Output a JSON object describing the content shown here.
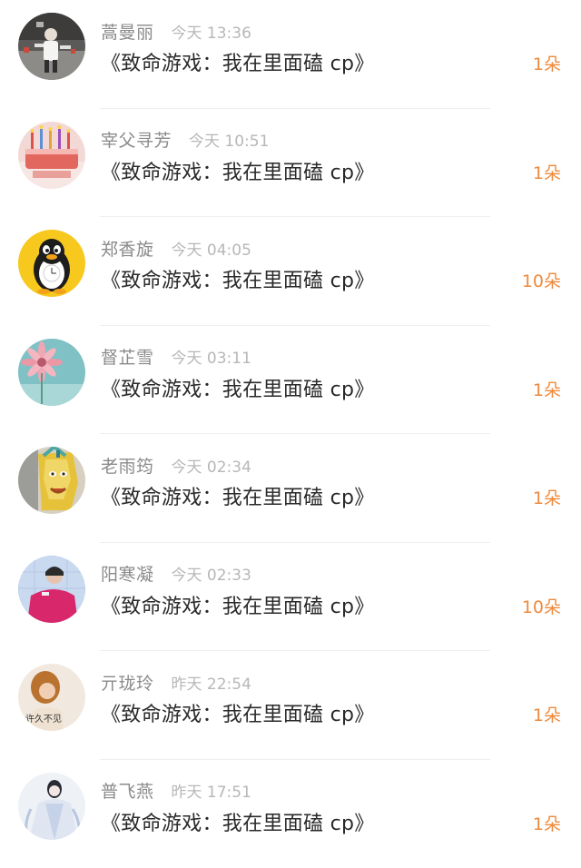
{
  "records": [
    {
      "name": "蒿曼丽",
      "time": "今天 13:36",
      "title": "《致命游戏：我在里面磕 cp》",
      "flowers": "1朵",
      "avatar": "person-photo-avatar"
    },
    {
      "name": "宰父寻芳",
      "time": "今天 10:51",
      "title": "《致命游戏：我在里面磕 cp》",
      "flowers": "1朵",
      "avatar": "birthday-cake-avatar"
    },
    {
      "name": "郑香旋",
      "time": "今天 04:05",
      "title": "《致命游戏：我在里面磕 cp》",
      "flowers": "10朵",
      "avatar": "penguin-avatar"
    },
    {
      "name": "督芷雪",
      "time": "今天 03:11",
      "title": "《致命游戏：我在里面磕 cp》",
      "flowers": "1朵",
      "avatar": "pink-flower-avatar"
    },
    {
      "name": "老雨筠",
      "time": "今天 02:34",
      "title": "《致命游戏：我在里面磕 cp》",
      "flowers": "1朵",
      "avatar": "cartoon-face-avatar"
    },
    {
      "name": "阳寒凝",
      "time": "今天 02:33",
      "title": "《致命游戏：我在里面磕 cp》",
      "flowers": "10朵",
      "avatar": "boy-pink-shirt-avatar"
    },
    {
      "name": "亓珑玲",
      "time": "昨天 22:54",
      "title": "《致命游戏：我在里面磕 cp》",
      "flowers": "1朵",
      "avatar": "girl-photo-avatar"
    },
    {
      "name": "普飞燕",
      "time": "昨天 17:51",
      "title": "《致命游戏：我在里面磕 cp》",
      "flowers": "1朵",
      "avatar": "ancient-costume-avatar"
    }
  ],
  "avatar_caption_7": "许久不见"
}
